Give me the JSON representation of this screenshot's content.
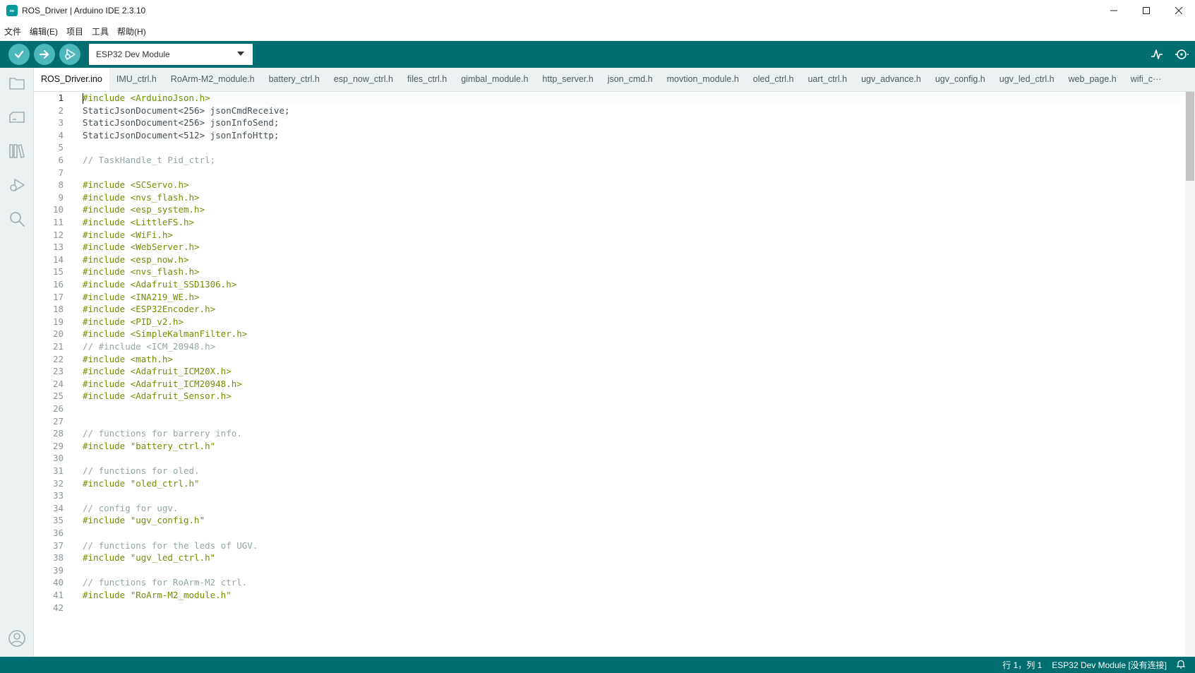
{
  "window": {
    "title": "ROS_Driver | Arduino IDE 2.3.10",
    "logo": "∞"
  },
  "menu": [
    "文件",
    "编辑(E)",
    "项目",
    "工具",
    "帮助(H)"
  ],
  "toolbar": {
    "board": "ESP32 Dev Module"
  },
  "tabs": [
    "ROS_Driver.ino",
    "IMU_ctrl.h",
    "RoArm-M2_module.h",
    "battery_ctrl.h",
    "esp_now_ctrl.h",
    "files_ctrl.h",
    "gimbal_module.h",
    "http_server.h",
    "json_cmd.h",
    "movtion_module.h",
    "oled_ctrl.h",
    "uart_ctrl.h",
    "ugv_advance.h",
    "ugv_config.h",
    "ugv_led_ctrl.h",
    "web_page.h",
    "wifi_c···"
  ],
  "editor": {
    "lines": [
      {
        "n": "1",
        "t": "kw",
        "text": "#include <ArduinoJson.h>"
      },
      {
        "n": "2",
        "t": "code",
        "text": "StaticJsonDocument<256> jsonCmdReceive;"
      },
      {
        "n": "3",
        "t": "code",
        "text": "StaticJsonDocument<256> jsonInfoSend;"
      },
      {
        "n": "4",
        "t": "code",
        "text": "StaticJsonDocument<512> jsonInfoHttp;"
      },
      {
        "n": "5",
        "t": "code",
        "text": ""
      },
      {
        "n": "6",
        "t": "cm",
        "text": "// TaskHandle_t Pid_ctrl;"
      },
      {
        "n": "7",
        "t": "code",
        "text": ""
      },
      {
        "n": "8",
        "t": "kw",
        "text": "#include <SCServo.h>"
      },
      {
        "n": "9",
        "t": "kw",
        "text": "#include <nvs_flash.h>"
      },
      {
        "n": "10",
        "t": "kw",
        "text": "#include <esp_system.h>"
      },
      {
        "n": "11",
        "t": "kw",
        "text": "#include <LittleFS.h>"
      },
      {
        "n": "12",
        "t": "kw",
        "text": "#include <WiFi.h>"
      },
      {
        "n": "13",
        "t": "kw",
        "text": "#include <WebServer.h>"
      },
      {
        "n": "14",
        "t": "kw",
        "text": "#include <esp_now.h>"
      },
      {
        "n": "15",
        "t": "kw",
        "text": "#include <nvs_flash.h>"
      },
      {
        "n": "16",
        "t": "kw",
        "text": "#include <Adafruit_SSD1306.h>"
      },
      {
        "n": "17",
        "t": "kw",
        "text": "#include <INA219_WE.h>"
      },
      {
        "n": "18",
        "t": "kw",
        "text": "#include <ESP32Encoder.h>"
      },
      {
        "n": "19",
        "t": "kw",
        "text": "#include <PID_v2.h>"
      },
      {
        "n": "20",
        "t": "kw",
        "text": "#include <SimpleKalmanFilter.h>"
      },
      {
        "n": "21",
        "t": "cm",
        "text": "// #include <ICM_20948.h>"
      },
      {
        "n": "22",
        "t": "kw",
        "text": "#include <math.h>"
      },
      {
        "n": "23",
        "t": "kw",
        "text": "#include <Adafruit_ICM20X.h>"
      },
      {
        "n": "24",
        "t": "kw",
        "text": "#include <Adafruit_ICM20948.h>"
      },
      {
        "n": "25",
        "t": "kw",
        "text": "#include <Adafruit_Sensor.h>"
      },
      {
        "n": "26",
        "t": "code",
        "text": ""
      },
      {
        "n": "27",
        "t": "code",
        "text": ""
      },
      {
        "n": "28",
        "t": "cm",
        "text": "// functions for barrery info."
      },
      {
        "n": "29",
        "t": "kw",
        "text": "#include \"battery_ctrl.h\""
      },
      {
        "n": "30",
        "t": "code",
        "text": ""
      },
      {
        "n": "31",
        "t": "cm",
        "text": "// functions for oled."
      },
      {
        "n": "32",
        "t": "kw",
        "text": "#include \"oled_ctrl.h\""
      },
      {
        "n": "33",
        "t": "code",
        "text": ""
      },
      {
        "n": "34",
        "t": "cm",
        "text": "// config for ugv."
      },
      {
        "n": "35",
        "t": "kw",
        "text": "#include \"ugv_config.h\""
      },
      {
        "n": "36",
        "t": "code",
        "text": ""
      },
      {
        "n": "37",
        "t": "cm",
        "text": "// functions for the leds of UGV."
      },
      {
        "n": "38",
        "t": "kw",
        "text": "#include \"ugv_led_ctrl.h\""
      },
      {
        "n": "39",
        "t": "code",
        "text": ""
      },
      {
        "n": "40",
        "t": "cm",
        "text": "// functions for RoArm-M2 ctrl."
      },
      {
        "n": "41",
        "t": "kw",
        "text": "#include \"RoArm-M2_module.h\""
      },
      {
        "n": "42",
        "t": "code",
        "text": ""
      }
    ]
  },
  "status": {
    "position": "行 1，列 1",
    "board": "ESP32 Dev Module [没有连接]"
  },
  "icons": {
    "verify": "check-icon",
    "upload": "arrow-right-icon",
    "debug": "debug-icon",
    "plotter": "serial-plotter-icon",
    "monitor": "serial-monitor-icon",
    "sketchbook": "folder-icon",
    "boards": "board-manager-icon",
    "library": "library-icon",
    "debugger": "debug-sidebar-icon",
    "search": "search-icon",
    "profile": "profile-icon",
    "bell": "bell-icon"
  },
  "colors": {
    "toolbar": "#006d70",
    "button": "#4db7bb",
    "keyword": "#728e00",
    "comment": "#95a5a6"
  }
}
